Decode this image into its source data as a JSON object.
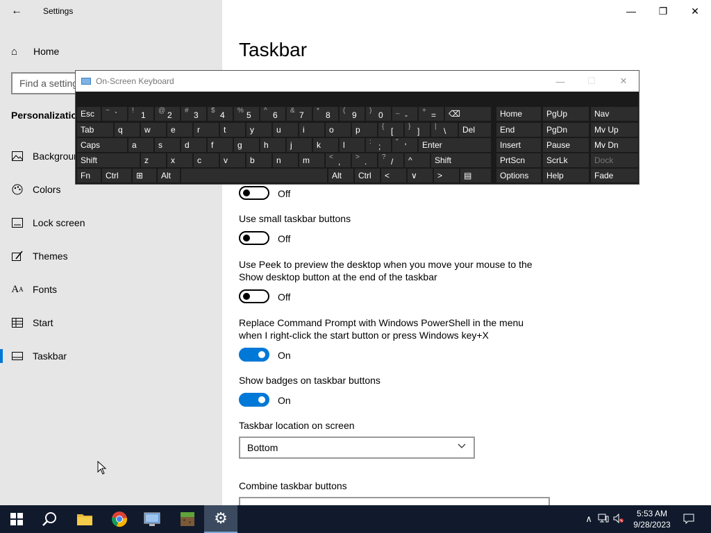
{
  "window": {
    "app_title": "Settings",
    "back_icon": "←",
    "minimize_icon": "—",
    "restore_icon": "❐",
    "close_icon": "✕"
  },
  "sidebar": {
    "home_label": "Home",
    "search_placeholder": "Find a setting",
    "section_title": "Personalization",
    "items": [
      {
        "label": "Background",
        "icon": "🖼"
      },
      {
        "label": "Colors",
        "icon": "◔"
      },
      {
        "label": "Lock screen",
        "icon": "▭"
      },
      {
        "label": "Themes",
        "icon": "✎"
      },
      {
        "label": "Fonts",
        "icon": "A"
      },
      {
        "label": "Start",
        "icon": "▤"
      },
      {
        "label": "Taskbar",
        "icon": "▭"
      }
    ]
  },
  "main": {
    "title": "Taskbar",
    "settings": [
      {
        "label": "",
        "state": "Off",
        "on": false
      },
      {
        "label": "Use small taskbar buttons",
        "state": "Off",
        "on": false
      },
      {
        "label": "Use Peek to preview the desktop when you move your mouse to the Show desktop button at the end of the taskbar",
        "state": "Off",
        "on": false
      },
      {
        "label": "Replace Command Prompt with Windows PowerShell in the menu when I right-click the start button or press Windows key+X",
        "state": "On",
        "on": true
      },
      {
        "label": "Show badges on taskbar buttons",
        "state": "On",
        "on": true
      }
    ],
    "location_label": "Taskbar location on screen",
    "location_value": "Bottom",
    "combine_label": "Combine taskbar buttons"
  },
  "osk": {
    "title": "On-Screen Keyboard",
    "minimize_icon": "—",
    "maximize_icon": "☐",
    "close_icon": "✕",
    "row1": [
      "Esc",
      "~ `",
      "! 1",
      "@ 2",
      "# 3",
      "$ 4",
      "% 5",
      "^ 6",
      "& 7",
      "* 8",
      "( 9",
      ") 0",
      "_ -",
      "+ =",
      "⌫"
    ],
    "row2": [
      "Tab",
      "q",
      "w",
      "e",
      "r",
      "t",
      "y",
      "u",
      "i",
      "o",
      "p",
      "{ [",
      "} ]",
      "| \\",
      "Del"
    ],
    "row3": [
      "Caps",
      "a",
      "s",
      "d",
      "f",
      "g",
      "h",
      "j",
      "k",
      "l",
      ": ;",
      "\" '",
      "Enter"
    ],
    "row4": [
      "Shift",
      "z",
      "x",
      "c",
      "v",
      "b",
      "n",
      "m",
      "< ,",
      "> .",
      "? /",
      "^",
      "Shift"
    ],
    "row5": [
      "Fn",
      "Ctrl",
      "⊞",
      "Alt",
      "",
      "Alt",
      "Ctrl",
      "<",
      "∨",
      ">",
      "▤"
    ],
    "nav": [
      [
        "Home",
        "PgUp",
        "Nav"
      ],
      [
        "End",
        "PgDn",
        "Mv Up"
      ],
      [
        "Insert",
        "Pause",
        "Mv Dn"
      ],
      [
        "PrtScn",
        "ScrLk",
        "Dock"
      ],
      [
        "Options",
        "Help",
        "Fade"
      ]
    ]
  },
  "taskbar": {
    "time": "5:53 AM",
    "date": "9/28/2023"
  },
  "colors": {
    "accent": "#0078d7",
    "taskbar_bg": "#101a2c",
    "osk_bg": "#1a1a1a"
  }
}
